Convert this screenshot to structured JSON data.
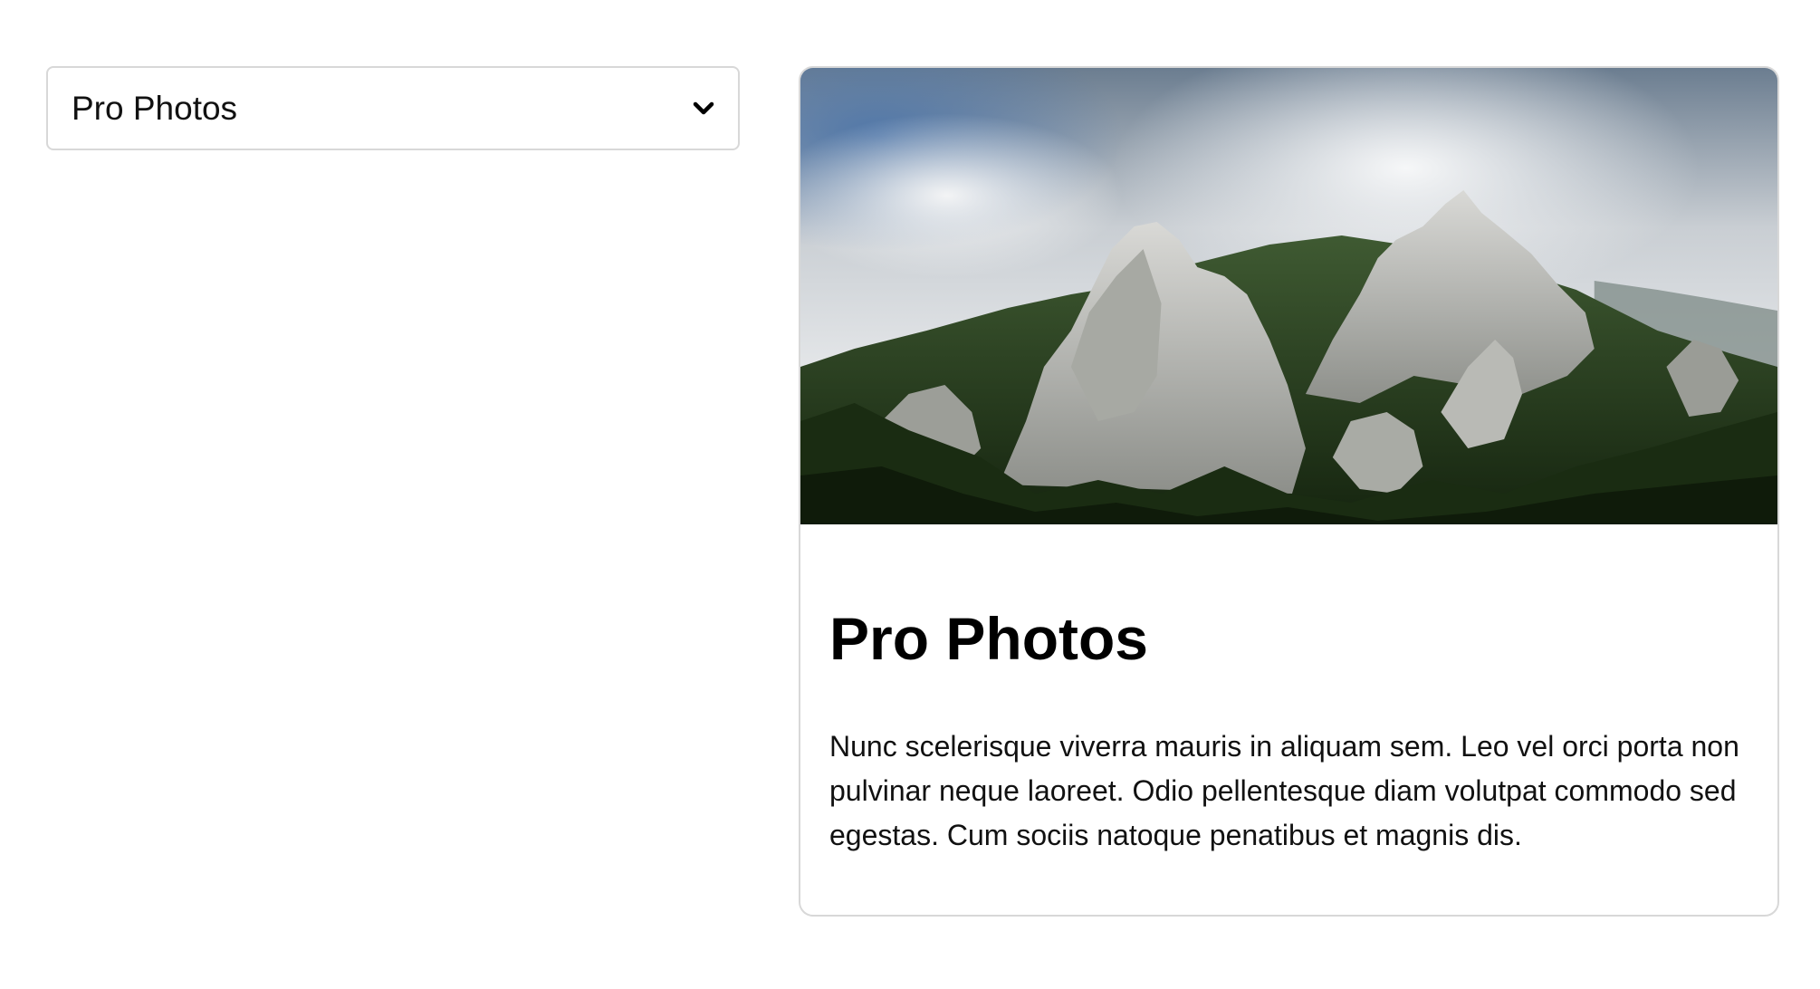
{
  "select": {
    "value": "Pro Photos",
    "icon": "chevron-down-icon"
  },
  "card": {
    "image_alt": "mountain-landscape",
    "title": "Pro Photos",
    "text": "Nunc scelerisque viverra mauris in aliquam sem. Leo vel orci porta non pulvinar neque laoreet. Odio pellentesque diam volutpat commodo sed egestas. Cum sociis natoque penatibus et magnis dis."
  }
}
